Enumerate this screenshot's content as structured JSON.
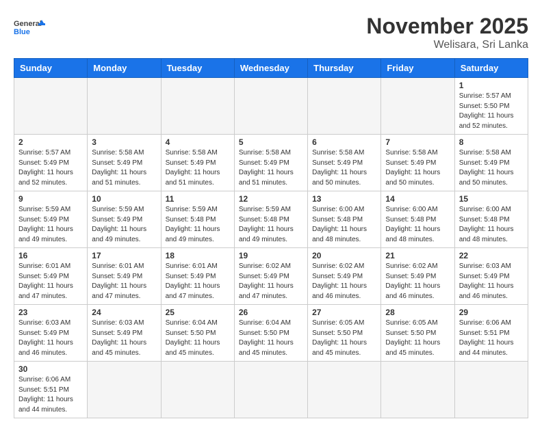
{
  "header": {
    "title": "November 2025",
    "location": "Welisara, Sri Lanka",
    "logo_general": "General",
    "logo_blue": "Blue"
  },
  "calendar": {
    "days_of_week": [
      "Sunday",
      "Monday",
      "Tuesday",
      "Wednesday",
      "Thursday",
      "Friday",
      "Saturday"
    ],
    "weeks": [
      [
        {
          "day": "",
          "info": ""
        },
        {
          "day": "",
          "info": ""
        },
        {
          "day": "",
          "info": ""
        },
        {
          "day": "",
          "info": ""
        },
        {
          "day": "",
          "info": ""
        },
        {
          "day": "",
          "info": ""
        },
        {
          "day": "1",
          "info": "Sunrise: 5:57 AM\nSunset: 5:50 PM\nDaylight: 11 hours\nand 52 minutes."
        }
      ],
      [
        {
          "day": "2",
          "info": "Sunrise: 5:57 AM\nSunset: 5:49 PM\nDaylight: 11 hours\nand 52 minutes."
        },
        {
          "day": "3",
          "info": "Sunrise: 5:58 AM\nSunset: 5:49 PM\nDaylight: 11 hours\nand 51 minutes."
        },
        {
          "day": "4",
          "info": "Sunrise: 5:58 AM\nSunset: 5:49 PM\nDaylight: 11 hours\nand 51 minutes."
        },
        {
          "day": "5",
          "info": "Sunrise: 5:58 AM\nSunset: 5:49 PM\nDaylight: 11 hours\nand 51 minutes."
        },
        {
          "day": "6",
          "info": "Sunrise: 5:58 AM\nSunset: 5:49 PM\nDaylight: 11 hours\nand 50 minutes."
        },
        {
          "day": "7",
          "info": "Sunrise: 5:58 AM\nSunset: 5:49 PM\nDaylight: 11 hours\nand 50 minutes."
        },
        {
          "day": "8",
          "info": "Sunrise: 5:58 AM\nSunset: 5:49 PM\nDaylight: 11 hours\nand 50 minutes."
        }
      ],
      [
        {
          "day": "9",
          "info": "Sunrise: 5:59 AM\nSunset: 5:49 PM\nDaylight: 11 hours\nand 49 minutes."
        },
        {
          "day": "10",
          "info": "Sunrise: 5:59 AM\nSunset: 5:49 PM\nDaylight: 11 hours\nand 49 minutes."
        },
        {
          "day": "11",
          "info": "Sunrise: 5:59 AM\nSunset: 5:48 PM\nDaylight: 11 hours\nand 49 minutes."
        },
        {
          "day": "12",
          "info": "Sunrise: 5:59 AM\nSunset: 5:48 PM\nDaylight: 11 hours\nand 49 minutes."
        },
        {
          "day": "13",
          "info": "Sunrise: 6:00 AM\nSunset: 5:48 PM\nDaylight: 11 hours\nand 48 minutes."
        },
        {
          "day": "14",
          "info": "Sunrise: 6:00 AM\nSunset: 5:48 PM\nDaylight: 11 hours\nand 48 minutes."
        },
        {
          "day": "15",
          "info": "Sunrise: 6:00 AM\nSunset: 5:48 PM\nDaylight: 11 hours\nand 48 minutes."
        }
      ],
      [
        {
          "day": "16",
          "info": "Sunrise: 6:01 AM\nSunset: 5:49 PM\nDaylight: 11 hours\nand 47 minutes."
        },
        {
          "day": "17",
          "info": "Sunrise: 6:01 AM\nSunset: 5:49 PM\nDaylight: 11 hours\nand 47 minutes."
        },
        {
          "day": "18",
          "info": "Sunrise: 6:01 AM\nSunset: 5:49 PM\nDaylight: 11 hours\nand 47 minutes."
        },
        {
          "day": "19",
          "info": "Sunrise: 6:02 AM\nSunset: 5:49 PM\nDaylight: 11 hours\nand 47 minutes."
        },
        {
          "day": "20",
          "info": "Sunrise: 6:02 AM\nSunset: 5:49 PM\nDaylight: 11 hours\nand 46 minutes."
        },
        {
          "day": "21",
          "info": "Sunrise: 6:02 AM\nSunset: 5:49 PM\nDaylight: 11 hours\nand 46 minutes."
        },
        {
          "day": "22",
          "info": "Sunrise: 6:03 AM\nSunset: 5:49 PM\nDaylight: 11 hours\nand 46 minutes."
        }
      ],
      [
        {
          "day": "23",
          "info": "Sunrise: 6:03 AM\nSunset: 5:49 PM\nDaylight: 11 hours\nand 46 minutes."
        },
        {
          "day": "24",
          "info": "Sunrise: 6:03 AM\nSunset: 5:49 PM\nDaylight: 11 hours\nand 45 minutes."
        },
        {
          "day": "25",
          "info": "Sunrise: 6:04 AM\nSunset: 5:50 PM\nDaylight: 11 hours\nand 45 minutes."
        },
        {
          "day": "26",
          "info": "Sunrise: 6:04 AM\nSunset: 5:50 PM\nDaylight: 11 hours\nand 45 minutes."
        },
        {
          "day": "27",
          "info": "Sunrise: 6:05 AM\nSunset: 5:50 PM\nDaylight: 11 hours\nand 45 minutes."
        },
        {
          "day": "28",
          "info": "Sunrise: 6:05 AM\nSunset: 5:50 PM\nDaylight: 11 hours\nand 45 minutes."
        },
        {
          "day": "29",
          "info": "Sunrise: 6:06 AM\nSunset: 5:51 PM\nDaylight: 11 hours\nand 44 minutes."
        }
      ],
      [
        {
          "day": "30",
          "info": "Sunrise: 6:06 AM\nSunset: 5:51 PM\nDaylight: 11 hours\nand 44 minutes."
        },
        {
          "day": "",
          "info": ""
        },
        {
          "day": "",
          "info": ""
        },
        {
          "day": "",
          "info": ""
        },
        {
          "day": "",
          "info": ""
        },
        {
          "day": "",
          "info": ""
        },
        {
          "day": "",
          "info": ""
        }
      ]
    ]
  }
}
